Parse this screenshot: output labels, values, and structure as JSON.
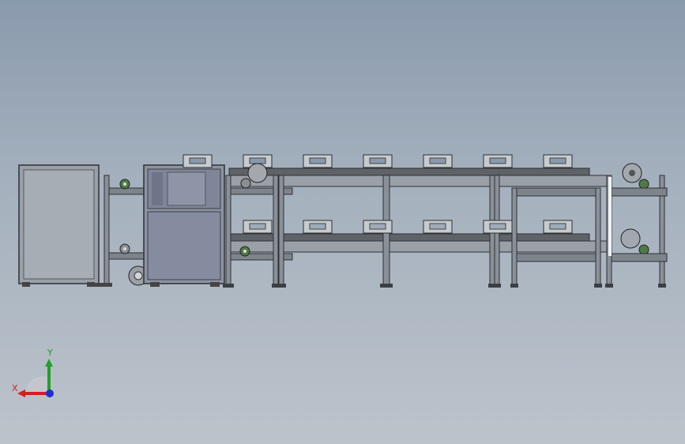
{
  "viewport": {
    "background_top": "#8a9aad",
    "background_bottom": "#bcc3cb"
  },
  "colors": {
    "frame": "#7d848c",
    "frame_dark": "#3c3f43",
    "cabinet_panel": "#8d93a3",
    "belt": "#5e6368",
    "motor": "#9aa0a6",
    "sprocket_green": "#4f7a45"
  },
  "triad": {
    "x_label": "X",
    "y_label": "Y",
    "x_color": "#d22020",
    "y_color": "#22a02a",
    "z_color": "#2030d0"
  }
}
